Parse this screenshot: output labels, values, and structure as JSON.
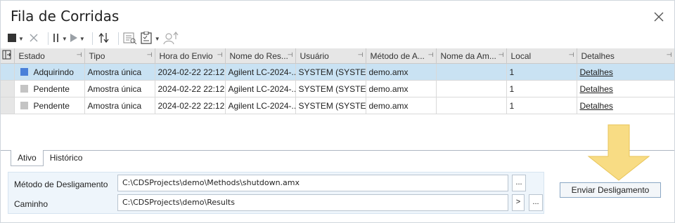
{
  "window": {
    "title": "Fila de Corridas"
  },
  "toolbar": {
    "buttons": [
      {
        "name": "stop-icon"
      },
      {
        "name": "cancel-icon"
      },
      {
        "name": "pause-icon"
      },
      {
        "name": "play-icon"
      },
      {
        "name": "sort-arrows-icon"
      },
      {
        "name": "run-details-icon"
      },
      {
        "name": "clipboard-checklist-icon"
      },
      {
        "name": "user-upload-icon"
      }
    ]
  },
  "table": {
    "columns": [
      "Estado",
      "Tipo",
      "Hora do Envio",
      "Nome do Res...",
      "Usuário",
      "Método de A...",
      "Nome da Am...",
      "Local",
      "Detalhes"
    ],
    "rows": [
      {
        "estado": "Adquirindo",
        "estado_color": "#4a80d9",
        "tipo": "Amostra única",
        "hora": "2024-02-22 22:12...",
        "nome_res": "Agilent LC-2024-...",
        "usuario": "SYSTEM (SYSTEM)",
        "metodo": "demo.amx",
        "nome_am": "",
        "local": "1",
        "detalhes": "Detalhes",
        "selected": true
      },
      {
        "estado": "Pendente",
        "estado_color": "#c4c4c4",
        "tipo": "Amostra única",
        "hora": "2024-02-22 22:12...",
        "nome_res": "Agilent LC-2024-...",
        "usuario": "SYSTEM (SYSTEM)",
        "metodo": "demo.amx",
        "nome_am": "",
        "local": "1",
        "detalhes": "Detalhes",
        "selected": false
      },
      {
        "estado": "Pendente",
        "estado_color": "#c4c4c4",
        "tipo": "Amostra única",
        "hora": "2024-02-22 22:12...",
        "nome_res": "Agilent LC-2024-...",
        "usuario": "SYSTEM (SYSTEM)",
        "metodo": "demo.amx",
        "nome_am": "",
        "local": "1",
        "detalhes": "Detalhes",
        "selected": false
      }
    ]
  },
  "tabs": [
    {
      "label": "Ativo",
      "active": true
    },
    {
      "label": "Histórico",
      "active": false
    }
  ],
  "shutdown": {
    "method_label": "Método de Desligamento",
    "method_value": "C:\\CDSProjects\\demo\\Methods\\shutdown.amx",
    "path_label": "Caminho",
    "path_value": "C:\\CDSProjects\\demo\\Results",
    "browse_label": "...",
    "arrow_label": ">",
    "send_label": "Enviar Desligamento"
  },
  "colors": {
    "selected_row": "#c9e2f3",
    "acquiring": "#4a80d9",
    "pending": "#c4c4c4",
    "hint_arrow": "#f8dc84"
  }
}
